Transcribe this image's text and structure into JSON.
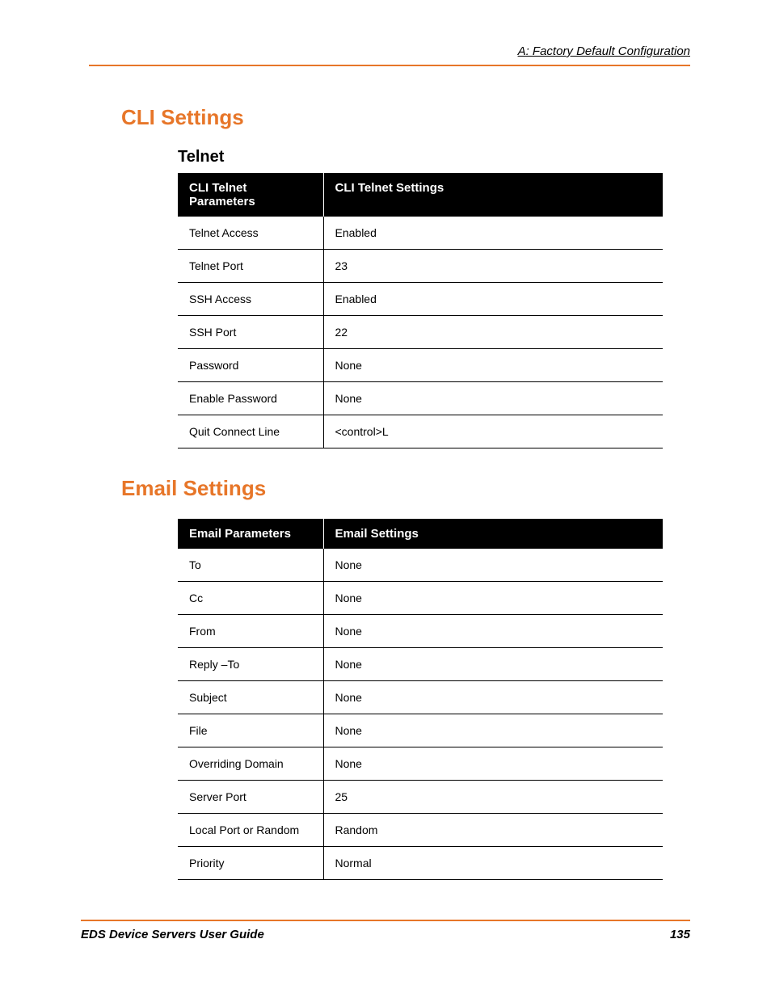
{
  "header": {
    "breadcrumb": "A: Factory Default Configuration"
  },
  "sections": {
    "cli": {
      "title": "CLI Settings",
      "sub": "Telnet",
      "th1": "CLI Telnet Parameters",
      "th2": "CLI Telnet Settings",
      "rows": [
        {
          "p": "Telnet Access",
          "v": "Enabled"
        },
        {
          "p": "Telnet Port",
          "v": "23"
        },
        {
          "p": "SSH Access",
          "v": "Enabled"
        },
        {
          "p": "SSH Port",
          "v": "22"
        },
        {
          "p": "Password",
          "v": "None"
        },
        {
          "p": "Enable Password",
          "v": "None"
        },
        {
          "p": "Quit Connect Line",
          "v": "<control>L"
        }
      ]
    },
    "email": {
      "title": "Email Settings",
      "th1": "Email Parameters",
      "th2": "Email Settings",
      "rows": [
        {
          "p": "To",
          "v": "None"
        },
        {
          "p": "Cc",
          "v": "None"
        },
        {
          "p": "From",
          "v": "None"
        },
        {
          "p": "Reply –To",
          "v": "None"
        },
        {
          "p": "Subject",
          "v": "None"
        },
        {
          "p": "File",
          "v": "None"
        },
        {
          "p": "Overriding Domain",
          "v": "None"
        },
        {
          "p": "Server Port",
          "v": "25"
        },
        {
          "p": "Local Port or Random",
          "v": "Random"
        },
        {
          "p": "Priority",
          "v": "Normal"
        }
      ]
    }
  },
  "footer": {
    "guide": "EDS Device Servers User Guide",
    "page": "135"
  }
}
